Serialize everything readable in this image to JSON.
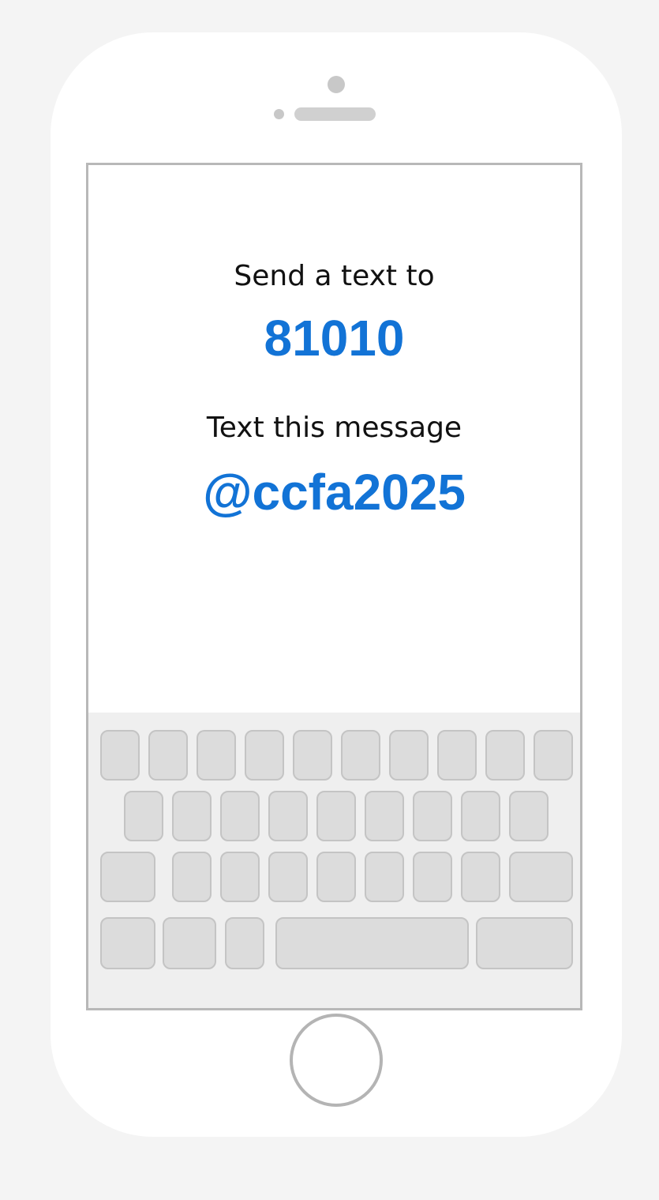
{
  "instructions": {
    "send_label": "Send a text to",
    "number": "81010",
    "message_label": "Text this message",
    "message": "@ccfa2025"
  },
  "colors": {
    "accent": "#1273d6",
    "text": "#111111",
    "background": "#f4f4f4",
    "key_fill": "#dcdcdc"
  },
  "icons": {
    "home_button": "home-button-icon",
    "camera": "camera-icon",
    "speaker": "speaker-icon"
  }
}
